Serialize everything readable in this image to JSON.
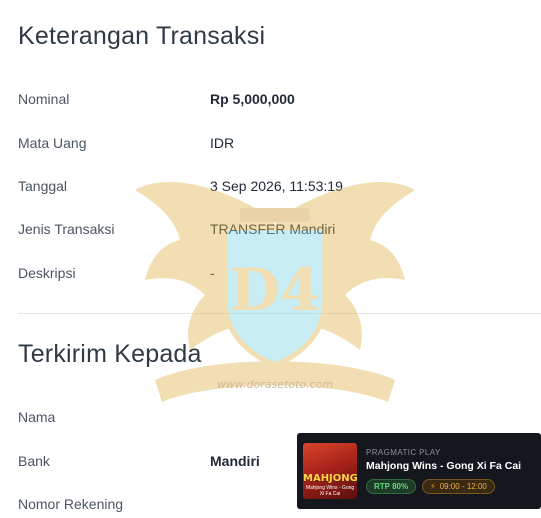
{
  "details": {
    "title": "Keterangan Transaksi",
    "rows": [
      {
        "label": "Nominal",
        "value": "Rp 5,000,000"
      },
      {
        "label": "Mata Uang",
        "value": "IDR"
      },
      {
        "label": "Tanggal",
        "value": "3 Sep 2026, 11:53:19"
      },
      {
        "label": "Jenis Transaksi",
        "value": "TRANSFER Mandiri"
      },
      {
        "label": "Deskripsi",
        "value": "-"
      }
    ]
  },
  "recipient": {
    "title": "Terkirim Kepada",
    "rows": [
      {
        "label": "Nama",
        "value": ""
      },
      {
        "label": "Bank",
        "value": "Mandiri"
      },
      {
        "label": "Nomor Rekening",
        "value": ""
      }
    ]
  },
  "watermark": {
    "monogram": "D4",
    "ribbon_text": "www.dorasetoto.com",
    "colors": {
      "gold": "#e0b24a",
      "cyan": "#7fd6e6"
    }
  },
  "promo": {
    "provider": "PRAGMATIC PLAY",
    "game": "Mahjong Wins - Gong Xi Fa Cai",
    "rtp": "RTP 80%",
    "time": "09:00 - 12:00",
    "thumb_title": "MAHJONG",
    "thumb_subtitle": "Mahjong Wins - Gong Xi Fa Cai",
    "bolt_icon": "bolt-icon"
  }
}
